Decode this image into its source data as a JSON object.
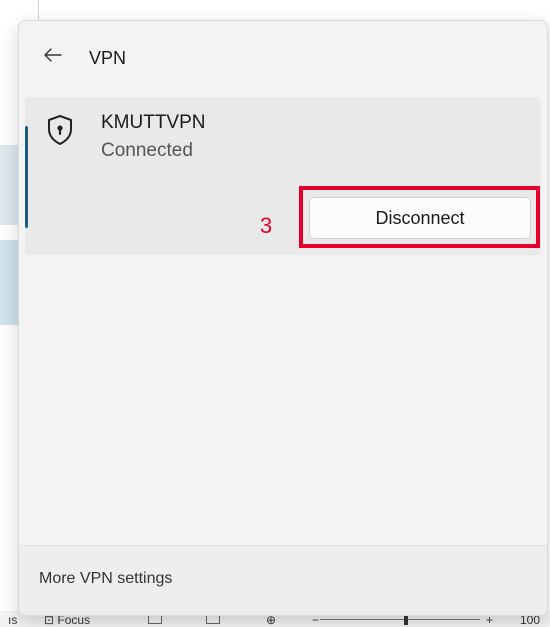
{
  "flyout": {
    "title": "VPN",
    "connection": {
      "name": "KMUTTVPN",
      "status": "Connected",
      "action_label": "Disconnect"
    },
    "footer_link": "More VPN settings"
  },
  "annotation": {
    "step_number": "3",
    "color": "#e4002b"
  },
  "statusbar": {
    "left_fragment": "ıs",
    "focus_label": "Focus",
    "zoom_minus": "−",
    "zoom_plus": "+",
    "zoom_value": "100"
  },
  "icons": {
    "back": "back-arrow-icon",
    "vpn": "shield-lock-icon"
  },
  "colors": {
    "accent": "#1b5f80",
    "flyout_bg": "#f3f3f3",
    "selected_item_bg": "#e9e9e9"
  }
}
